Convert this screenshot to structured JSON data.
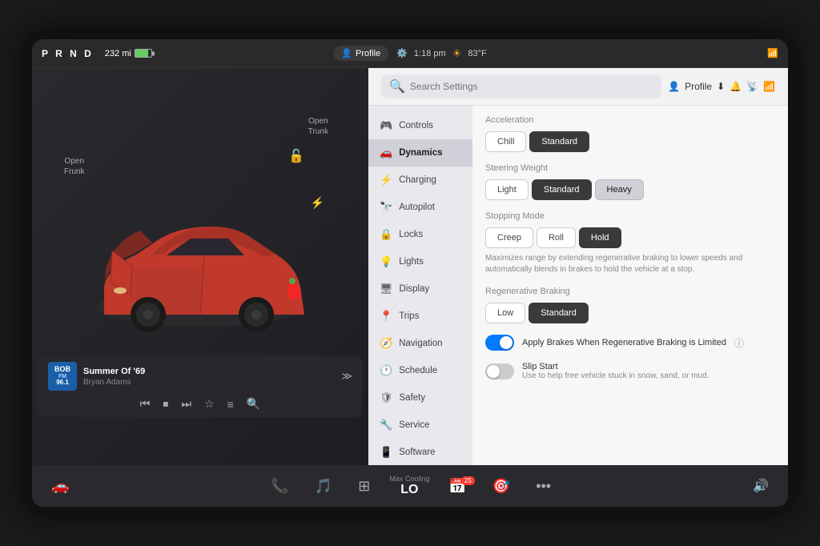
{
  "statusBar": {
    "prnd": "P R N D",
    "range": "232 mi",
    "profile_label": "Profile",
    "time": "1:18 pm",
    "temp": "83°F"
  },
  "carPanel": {
    "openTrunk": "Open\nTrunk",
    "openFrunk": "Open\nFrunk"
  },
  "music": {
    "radioLine1": "BOB",
    "radioLine2": "FM",
    "radioLine3": "96.1",
    "songTitle": "Summer Of '69",
    "artist": "Bryan Adams"
  },
  "settingsHeader": {
    "searchPlaceholder": "Search Settings",
    "profileLabel": "Profile"
  },
  "navItems": [
    {
      "icon": "🎮",
      "label": "Controls"
    },
    {
      "icon": "🚗",
      "label": "Dynamics"
    },
    {
      "icon": "⚡",
      "label": "Charging"
    },
    {
      "icon": "🔭",
      "label": "Autopilot"
    },
    {
      "icon": "🔒",
      "label": "Locks"
    },
    {
      "icon": "💡",
      "label": "Lights"
    },
    {
      "icon": "🖥",
      "label": "Display"
    },
    {
      "icon": "📍",
      "label": "Trips"
    },
    {
      "icon": "🧭",
      "label": "Navigation"
    },
    {
      "icon": "🕐",
      "label": "Schedule"
    },
    {
      "icon": "🛡",
      "label": "Safety"
    },
    {
      "icon": "🔧",
      "label": "Service"
    },
    {
      "icon": "📱",
      "label": "Software"
    }
  ],
  "dynamics": {
    "accelerationTitle": "Acceleration",
    "accelOptions": [
      "Chill",
      "Standard"
    ],
    "accelActive": "Standard",
    "steeringTitle": "Steering Weight",
    "steeringOptions": [
      "Light",
      "Standard",
      "Heavy"
    ],
    "steeringActive": "Standard",
    "stoppingTitle": "Stopping Mode",
    "stoppingOptions": [
      "Creep",
      "Roll",
      "Hold"
    ],
    "stoppingActive": "Hold",
    "stoppingDesc": "Maximizes range by extending regenerative braking to lower speeds and automatically blends in brakes to hold the vehicle at a stop.",
    "regenTitle": "Regenerative Braking",
    "regenOptions": [
      "Low",
      "Standard"
    ],
    "regenActive": "Standard",
    "applyBrakesLabel": "Apply Brakes When Regenerative Braking is Limited",
    "applyBrakesOn": true,
    "slipStartLabel": "Slip Start",
    "slipStartDesc": "Use to help free vehicle stuck in snow, sand, or mud.",
    "slipStartOn": false
  },
  "taskbar": {
    "climateLabel": "Max Cooling",
    "climateValue": "LO",
    "calendarBadge": "25"
  }
}
